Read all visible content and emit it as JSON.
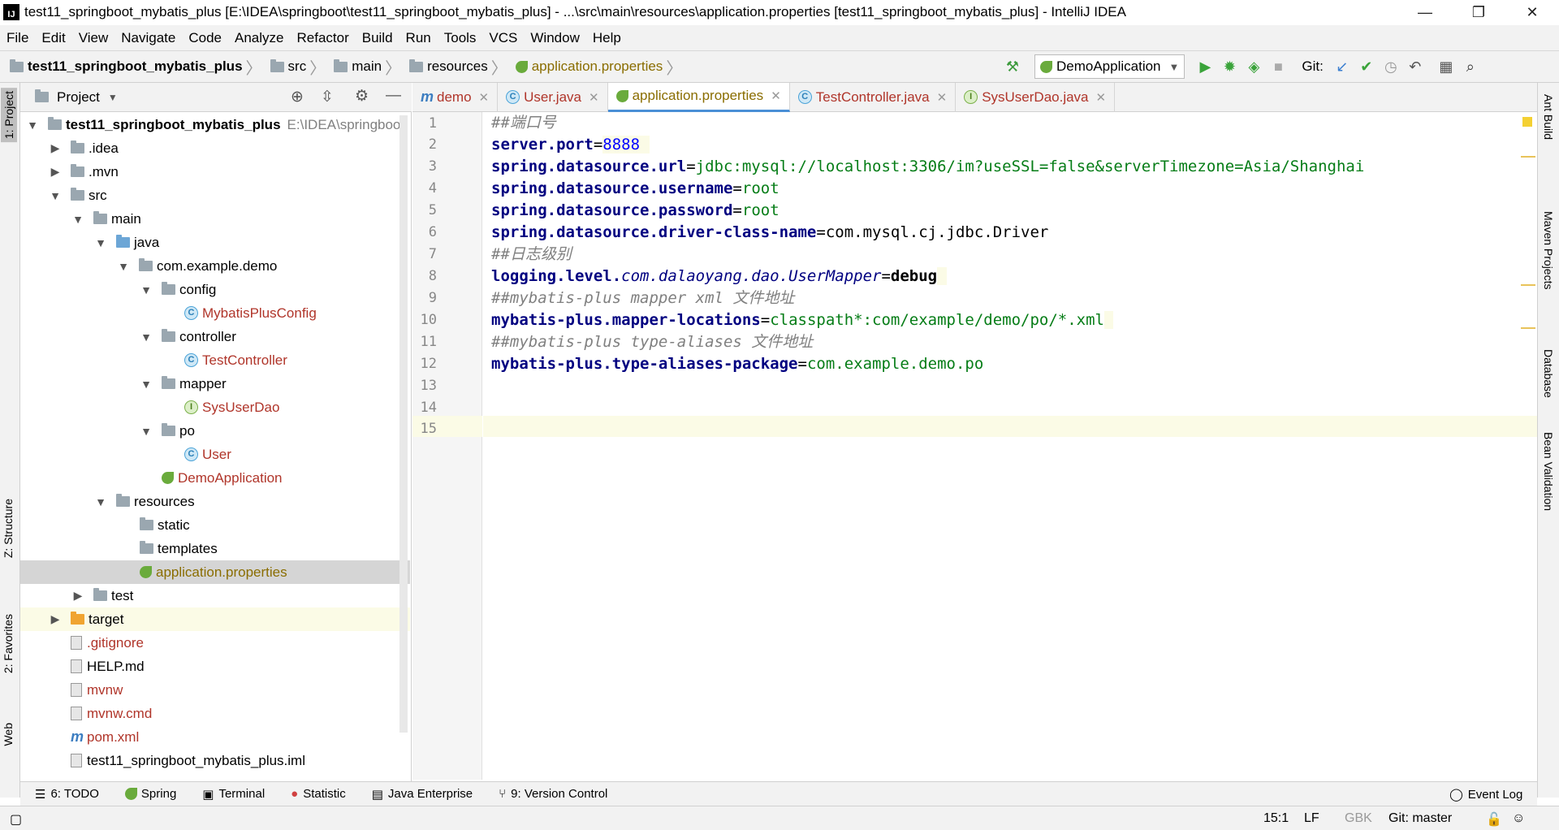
{
  "window": {
    "title": "test11_springboot_mybatis_plus [E:\\IDEA\\springboot\\test11_springboot_mybatis_plus] - ...\\src\\main\\resources\\application.properties [test11_springboot_mybatis_plus] - IntelliJ IDEA",
    "logo": "IJ",
    "minimize": "—",
    "maximize": "❐",
    "close": "✕"
  },
  "menu": [
    "File",
    "Edit",
    "View",
    "Navigate",
    "Code",
    "Analyze",
    "Refactor",
    "Build",
    "Run",
    "Tools",
    "VCS",
    "Window",
    "Help"
  ],
  "breadcrumb": {
    "project": "test11_springboot_mybatis_plus",
    "src": "src",
    "main": "main",
    "resources": "resources",
    "file": "application.properties"
  },
  "toolbar": {
    "run_config": "DemoApplication",
    "git_label": "Git:"
  },
  "left_tabs": {
    "project": "1: Project",
    "structure": "Z: Structure",
    "favorites": "2: Favorites",
    "web": "Web"
  },
  "right_tabs": {
    "ant": "Ant Build",
    "maven": "Maven Projects",
    "database": "Database",
    "bean": "Bean Validation"
  },
  "project_panel": {
    "title": "Project",
    "root_name": "test11_springboot_mybatis_plus",
    "root_path": "E:\\IDEA\\springboot",
    "items": {
      "idea": ".idea",
      "mvn": ".mvn",
      "src": "src",
      "main": "main",
      "java": "java",
      "pkg": "com.example.demo",
      "config": "config",
      "mybatis_cfg": "MybatisPlusConfig",
      "controller": "controller",
      "test_ctrl": "TestController",
      "mapper": "mapper",
      "sysuserdao": "SysUserDao",
      "po": "po",
      "user": "User",
      "demoapp": "DemoApplication",
      "resources": "resources",
      "static": "static",
      "templates": "templates",
      "app_props": "application.properties",
      "test": "test",
      "target": "target",
      "gitignore": ".gitignore",
      "help": "HELP.md",
      "mvnw": "mvnw",
      "mvnw_cmd": "mvnw.cmd",
      "pom": "pom.xml",
      "iml": "test11_springboot_mybatis_plus.iml"
    }
  },
  "tabs": {
    "demo": "demo",
    "user": "User.java",
    "props": "application.properties",
    "testctrl": "TestController.java",
    "sysuserdao": "SysUserDao.java"
  },
  "code": {
    "l1": "##端口号",
    "l2_k": "server.port",
    "l2_v": "8888",
    "l3_k": "spring.datasource.url",
    "l3_v": "jdbc:mysql://localhost:3306/im?useSSL=false&serverTimezone=Asia/Shanghai",
    "l4_k": "spring.datasource.username",
    "l4_v": "root",
    "l5_k": "spring.datasource.password",
    "l5_v": "root",
    "l6_k": "spring.datasource.driver-class-name",
    "l6_v": "com.mysql.cj.jdbc.Driver",
    "l7": "##日志级别",
    "l8_k": "logging.level.",
    "l8_p": "com.dalaoyang.dao.UserMapper",
    "l8_v": "debug",
    "l9": "##mybatis-plus mapper xml 文件地址",
    "l10_k": "mybatis-plus.mapper-locations",
    "l10_v": "classpath*:com/example/demo/po/*.xml",
    "l11": "##mybatis-plus type-aliases 文件地址",
    "l12_k": "mybatis-plus.type-aliases-package",
    "l12_v": "com.example.demo.po"
  },
  "bottom_tabs": {
    "todo": "6: TODO",
    "spring": "Spring",
    "terminal": "Terminal",
    "statistic": "Statistic",
    "java_ent": "Java Enterprise",
    "vcs": "9: Version Control",
    "event_log": "Event Log"
  },
  "status": {
    "position": "15:1",
    "line_sep": "LF",
    "encoding": "GBK",
    "git_branch": "Git: master"
  }
}
